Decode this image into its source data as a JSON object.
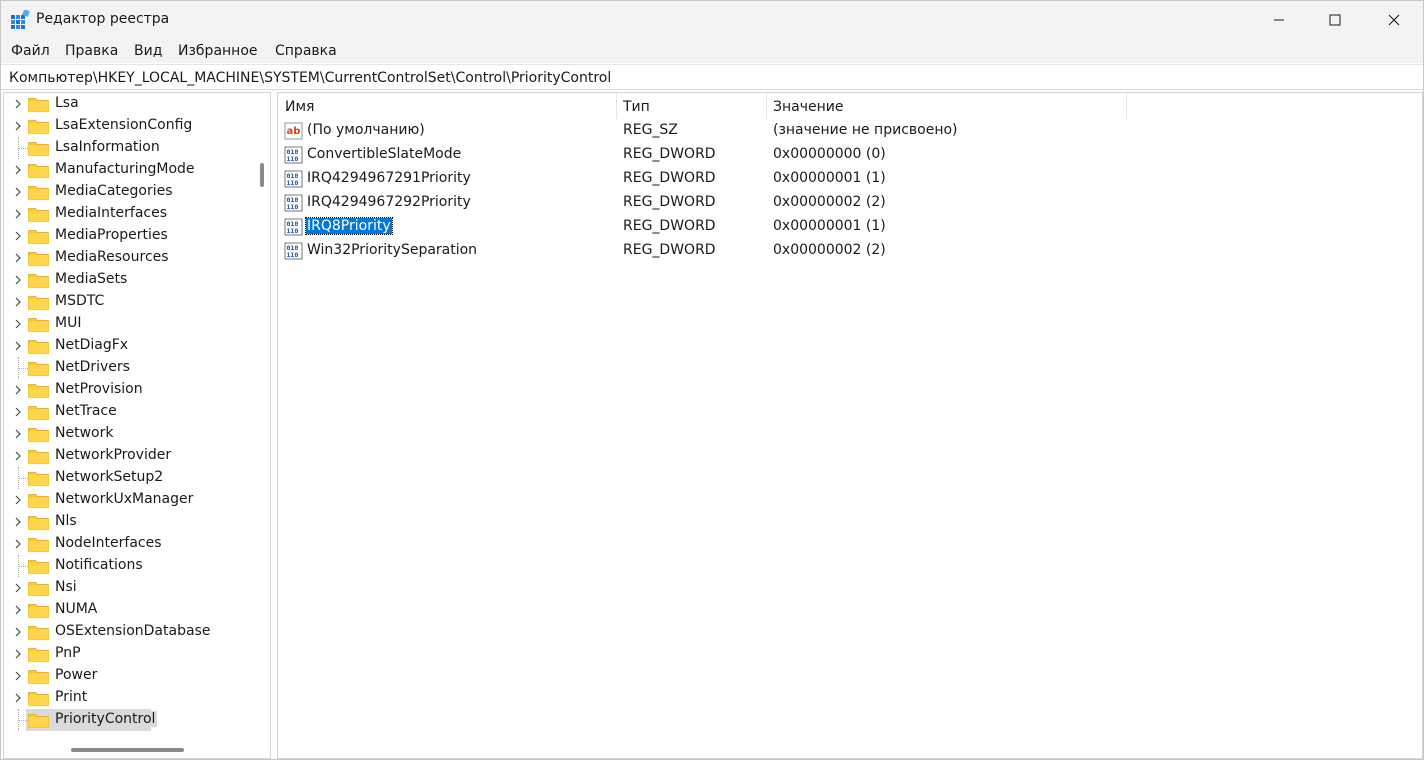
{
  "window": {
    "title": "Редактор реестра"
  },
  "menu": {
    "items": [
      "Файл",
      "Правка",
      "Вид",
      "Избранное",
      "Справка"
    ]
  },
  "address": {
    "path": "Компьютер\\HKEY_LOCAL_MACHINE\\SYSTEM\\CurrentControlSet\\Control\\PriorityControl"
  },
  "tree": {
    "items": [
      {
        "label": "Lsa",
        "expandable": true
      },
      {
        "label": "LsaExtensionConfig",
        "expandable": true
      },
      {
        "label": "LsaInformation",
        "expandable": false
      },
      {
        "label": "ManufacturingMode",
        "expandable": true
      },
      {
        "label": "MediaCategories",
        "expandable": true
      },
      {
        "label": "MediaInterfaces",
        "expandable": true
      },
      {
        "label": "MediaProperties",
        "expandable": true
      },
      {
        "label": "MediaResources",
        "expandable": true
      },
      {
        "label": "MediaSets",
        "expandable": true
      },
      {
        "label": "MSDTC",
        "expandable": true
      },
      {
        "label": "MUI",
        "expandable": true
      },
      {
        "label": "NetDiagFx",
        "expandable": true
      },
      {
        "label": "NetDrivers",
        "expandable": false
      },
      {
        "label": "NetProvision",
        "expandable": true
      },
      {
        "label": "NetTrace",
        "expandable": true
      },
      {
        "label": "Network",
        "expandable": true
      },
      {
        "label": "NetworkProvider",
        "expandable": true
      },
      {
        "label": "NetworkSetup2",
        "expandable": false
      },
      {
        "label": "NetworkUxManager",
        "expandable": true
      },
      {
        "label": "Nls",
        "expandable": true
      },
      {
        "label": "NodeInterfaces",
        "expandable": true
      },
      {
        "label": "Notifications",
        "expandable": false
      },
      {
        "label": "Nsi",
        "expandable": true
      },
      {
        "label": "NUMA",
        "expandable": true
      },
      {
        "label": "OSExtensionDatabase",
        "expandable": true
      },
      {
        "label": "PnP",
        "expandable": true
      },
      {
        "label": "Power",
        "expandable": true
      },
      {
        "label": "Print",
        "expandable": true
      },
      {
        "label": "PriorityControl",
        "expandable": false,
        "selected": true
      }
    ]
  },
  "list": {
    "columns": {
      "name": "Имя",
      "type": "Тип",
      "data": "Значение"
    },
    "rows": [
      {
        "name": "(По умолчанию)",
        "type": "REG_SZ",
        "data": "(значение не присвоено)",
        "icon": "string-value-icon"
      },
      {
        "name": "ConvertibleSlateMode",
        "type": "REG_DWORD",
        "data": "0x00000000 (0)",
        "icon": "binary-value-icon"
      },
      {
        "name": "IRQ4294967291Priority",
        "type": "REG_DWORD",
        "data": "0x00000001 (1)",
        "icon": "binary-value-icon"
      },
      {
        "name": "IRQ4294967292Priority",
        "type": "REG_DWORD",
        "data": "0x00000002 (2)",
        "icon": "binary-value-icon"
      },
      {
        "name": "IRQ8Priority",
        "type": "REG_DWORD",
        "data": "0x00000001 (1)",
        "icon": "binary-value-icon",
        "selected": true
      },
      {
        "name": "Win32PrioritySeparation",
        "type": "REG_DWORD",
        "data": "0x00000002 (2)",
        "icon": "binary-value-icon"
      }
    ]
  },
  "colors": {
    "selection": "#0078d7",
    "tree_selection": "#dadada",
    "folder": "#ffca28",
    "titlebar": "#f3f3f3"
  }
}
